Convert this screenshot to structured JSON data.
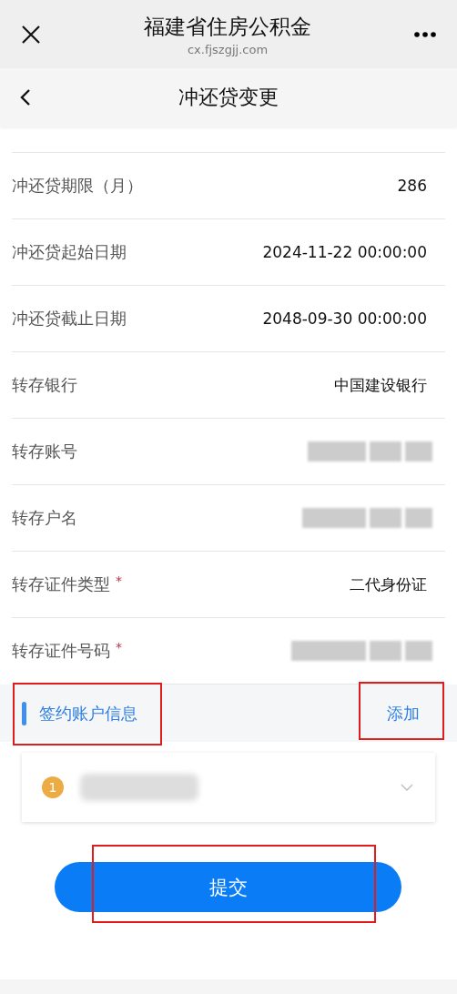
{
  "header": {
    "title": "福建省住房公积金",
    "url": "cx.fjszgjj.com"
  },
  "nav": {
    "title": "冲还贷变更"
  },
  "fields": [
    {
      "label": "冲还贷期限（月）",
      "kind": "text",
      "value": "286"
    },
    {
      "label": "冲还贷起始日期",
      "kind": "text",
      "value": "2024-11-22 00:00:00"
    },
    {
      "label": "冲还贷截止日期",
      "kind": "text",
      "value": "2048-09-30 00:00:00"
    },
    {
      "label": "转存银行",
      "kind": "text",
      "value": "中国建设银行"
    },
    {
      "label": "转存账号",
      "kind": "masked"
    },
    {
      "label": "转存户名",
      "kind": "masked"
    },
    {
      "label": "转存证件类型",
      "kind": "text",
      "value": "二代身份证",
      "required_mark": "*"
    },
    {
      "label": "转存证件号码",
      "kind": "masked",
      "required_mark": "*"
    }
  ],
  "section": {
    "title": "签约账户信息",
    "action": "添加",
    "highlighted": true
  },
  "accounts": [
    {
      "index": "1",
      "expanded": false
    }
  ],
  "submit": {
    "label": "提交",
    "highlighted": true
  }
}
